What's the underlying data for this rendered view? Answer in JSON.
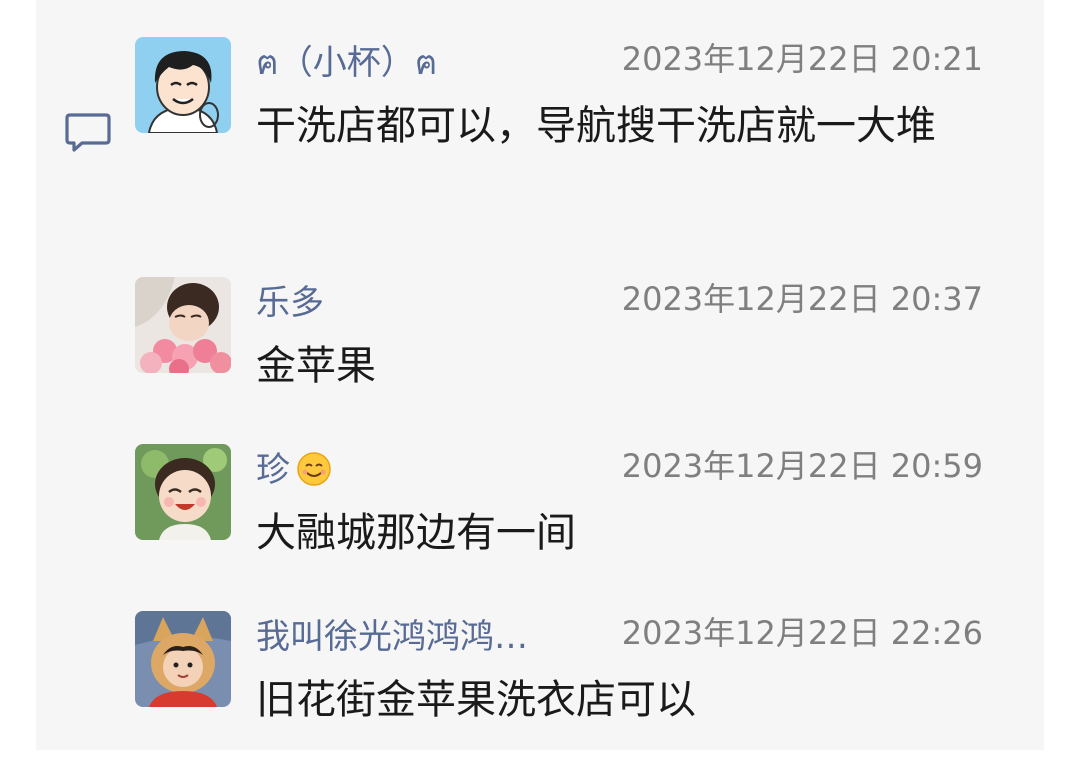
{
  "comments": [
    {
      "name": "ฅ（小杯）ฅ",
      "time": "2023年12月22日 20:21",
      "text": "干洗店都可以，导航搜干洗店就一大堆",
      "avatar": "boy-cartoon-avatar"
    },
    {
      "name": "乐多",
      "time": "2023年12月22日 20:37",
      "text": "金苹果",
      "avatar": "girl-flowers-avatar"
    },
    {
      "name": "珍",
      "name_emoji": "smiling-face-emoji",
      "time": "2023年12月22日 20:59",
      "text": "大融城那边有一间",
      "avatar": "girl-3d-avatar"
    },
    {
      "name": "我叫徐光鸿鸿鸿…",
      "time": "2023年12月22日 22:26",
      "text": "旧花街金苹果洗衣店可以",
      "avatar": "girl-costume-avatar"
    }
  ],
  "icons": {
    "comment": "comment-bubble-icon"
  },
  "colors": {
    "name": "#576b95",
    "time": "#7f7f7f",
    "text": "#1a1a1a",
    "panel": "#f6f6f6"
  }
}
